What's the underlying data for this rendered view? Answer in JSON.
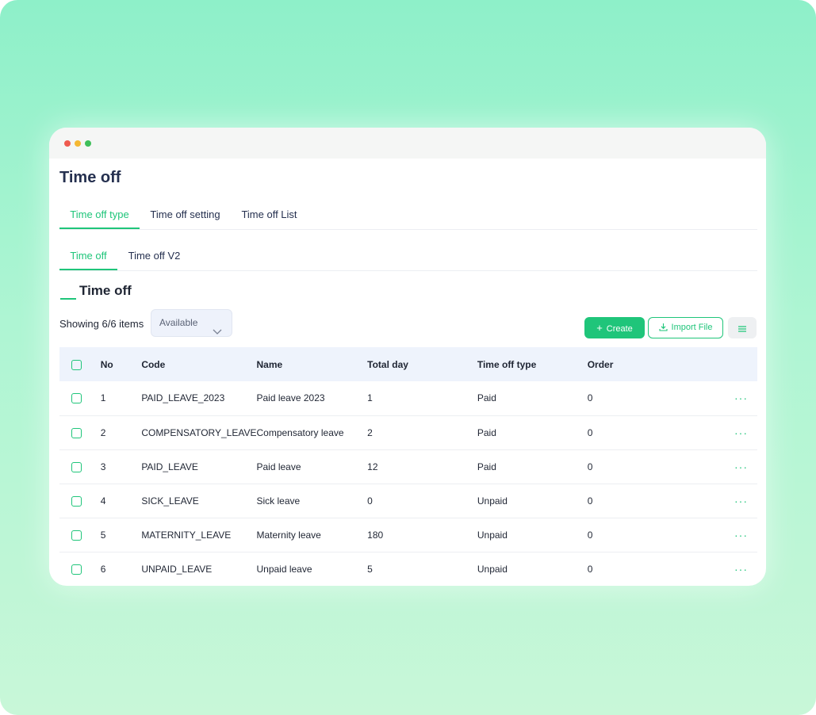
{
  "page": {
    "title": "Time off"
  },
  "tabs_primary": [
    {
      "label": "Time off type",
      "active": true
    },
    {
      "label": "Time off setting",
      "active": false
    },
    {
      "label": "Time off List",
      "active": false
    }
  ],
  "tabs_secondary": [
    {
      "label": "Time off",
      "active": true
    },
    {
      "label": "Time off V2",
      "active": false
    }
  ],
  "section": {
    "title": "Time off"
  },
  "toolbar": {
    "showing_text": "Showing 6/6 items",
    "filter_value": "Available",
    "create_label": "Create",
    "import_label": "Import File"
  },
  "table": {
    "headers": [
      "No",
      "Code",
      "Name",
      "Total day",
      "Time off type",
      "Order"
    ],
    "rows": [
      {
        "no": "1",
        "code": "PAID_LEAVE_2023",
        "name": "Paid leave 2023",
        "total_day": "1",
        "type": "Paid",
        "order": "0"
      },
      {
        "no": "2",
        "code": "COMPENSATORY_LEAVE",
        "name": "Compensatory leave",
        "total_day": "2",
        "type": "Paid",
        "order": "0"
      },
      {
        "no": "3",
        "code": "PAID_LEAVE",
        "name": "Paid leave",
        "total_day": "12",
        "type": "Paid",
        "order": "0"
      },
      {
        "no": "4",
        "code": "SICK_LEAVE",
        "name": "Sick leave",
        "total_day": "0",
        "type": "Unpaid",
        "order": "0"
      },
      {
        "no": "5",
        "code": "MATERNITY_LEAVE",
        "name": "Maternity leave",
        "total_day": "180",
        "type": "Unpaid",
        "order": "0"
      },
      {
        "no": "6",
        "code": "UNPAID_LEAVE",
        "name": "Unpaid leave",
        "total_day": "5",
        "type": "Unpaid",
        "order": "0"
      }
    ],
    "row_action": "···"
  },
  "colors": {
    "accent": "#1fc57a",
    "header_bg": "#eef3fc",
    "title": "#25304f"
  }
}
